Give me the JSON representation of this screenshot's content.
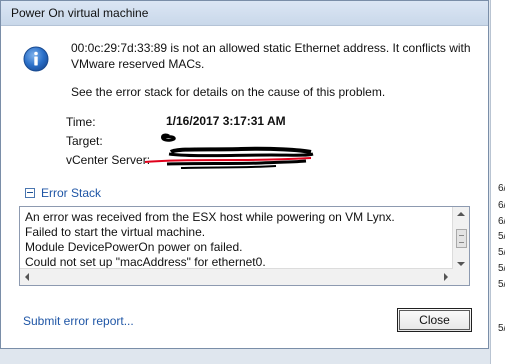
{
  "window": {
    "title": "Power On virtual machine"
  },
  "message": {
    "line1": "00:0c:29:7d:33:89 is not an allowed static Ethernet address. It conflicts with VMware reserved MACs.",
    "line2": "See the error stack for details on the cause of this problem."
  },
  "details": {
    "time_label": "Time:",
    "time_value": "1/16/2017 3:17:31 AM",
    "target_label": "Target:",
    "vcenter_label": "vCenter Server:"
  },
  "error_stack": {
    "header": "Error Stack",
    "lines": [
      "An error was received from the ESX host while powering on VM Lynx.",
      "Failed to start the virtual machine.",
      "Module DevicePowerOn power on failed.",
      "Could not set up \"macAddress\" for ethernet0."
    ]
  },
  "footer": {
    "submit_link": "Submit error report...",
    "close_button": "Close"
  },
  "background_window": {
    "lines": [
      "6/",
      "6/",
      "6/",
      "5/",
      "5/",
      "5/",
      "5/",
      "5/"
    ]
  },
  "colors": {
    "link": "#1f56a6",
    "scribble_black": "#000000",
    "scribble_red": "#e0001b"
  }
}
